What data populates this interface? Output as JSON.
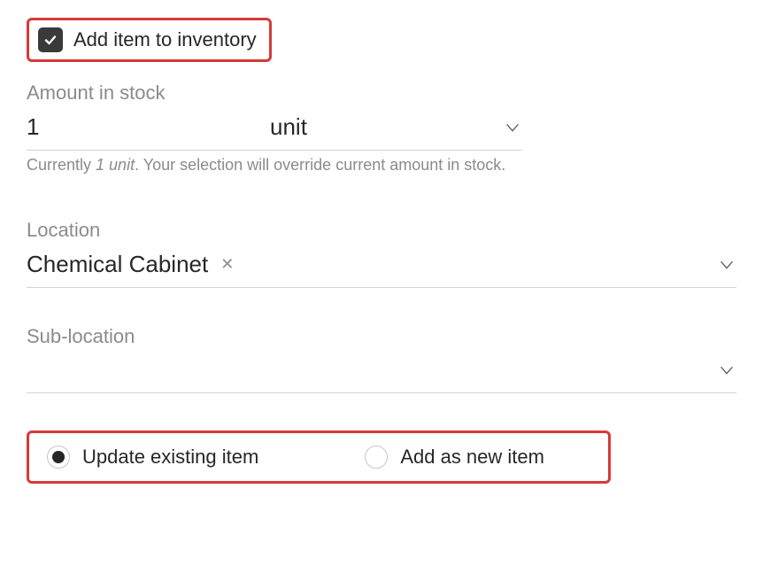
{
  "checkbox": {
    "label": "Add item to inventory",
    "checked": true
  },
  "amount": {
    "label": "Amount in stock",
    "value": "1",
    "unit": "unit",
    "helper_prefix": "Currently ",
    "helper_italic": "1 unit",
    "helper_suffix": ". Your selection will override current amount in stock."
  },
  "location": {
    "label": "Location",
    "value": "Chemical Cabinet"
  },
  "sublocation": {
    "label": "Sub-location",
    "value": ""
  },
  "radios": {
    "update_label": "Update existing item",
    "add_label": "Add as new item",
    "selected": "update"
  }
}
